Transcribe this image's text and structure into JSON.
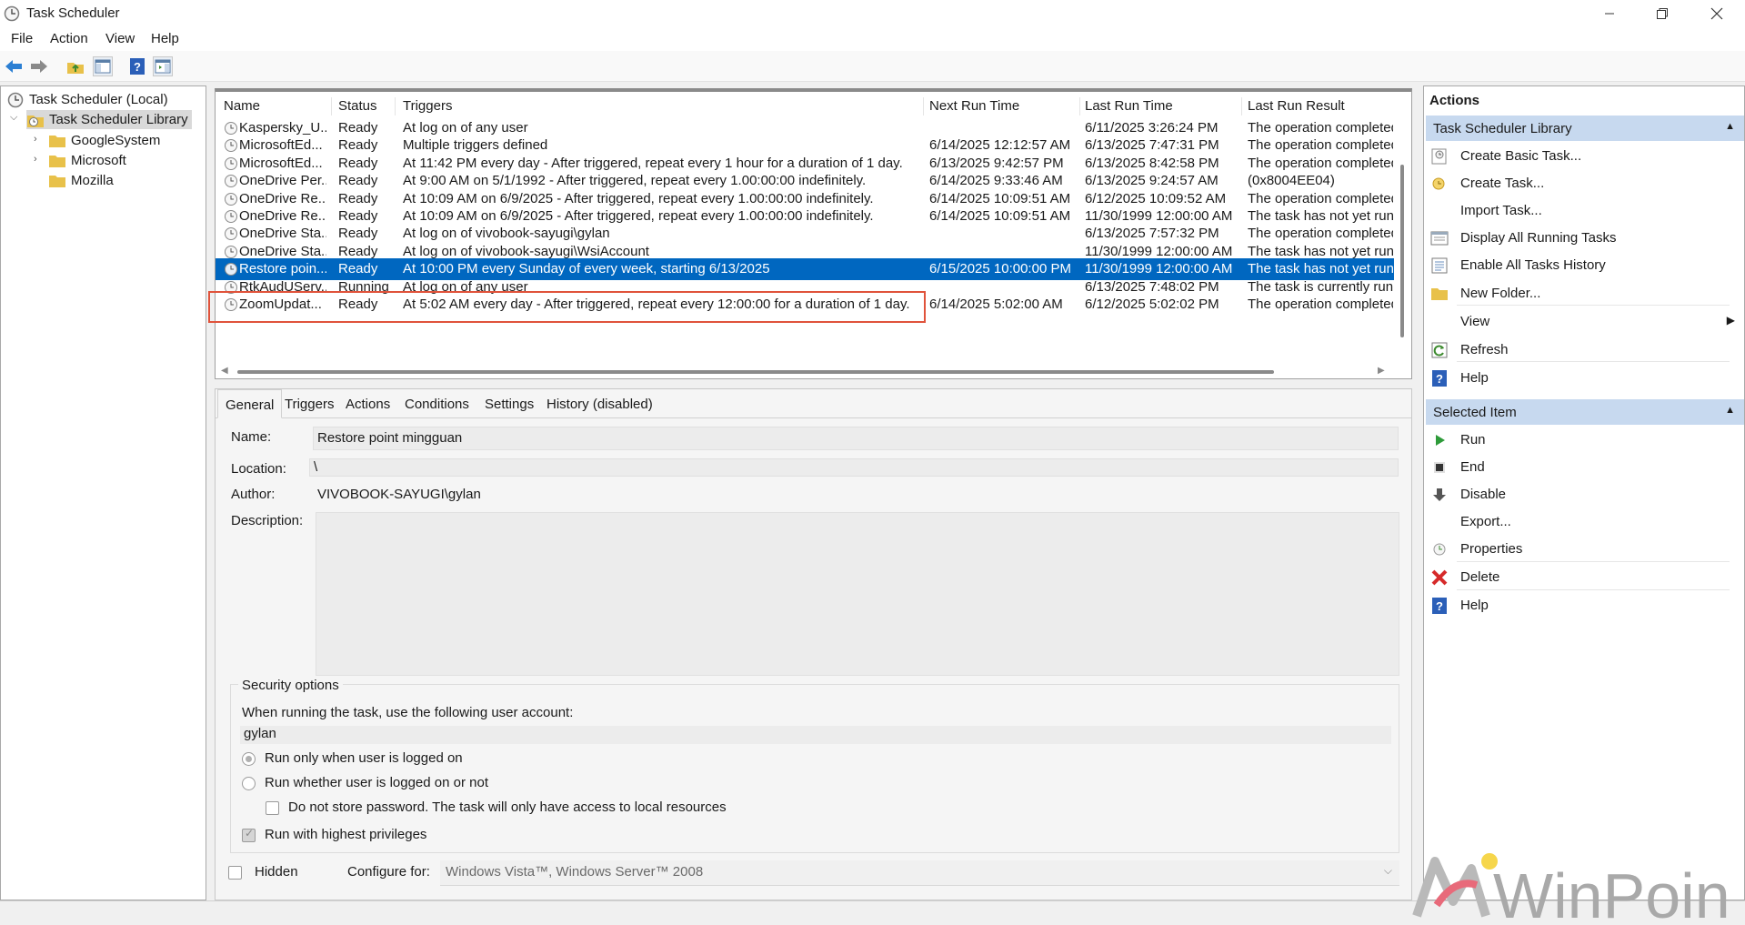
{
  "window": {
    "title": "Task Scheduler"
  },
  "menu": [
    "File",
    "Action",
    "View",
    "Help"
  ],
  "tree": {
    "root": "Task Scheduler (Local)",
    "library": "Task Scheduler Library",
    "folders": [
      "GoogleSystem",
      "Microsoft",
      "Mozilla"
    ]
  },
  "tasks": {
    "columns": [
      "Name",
      "Status",
      "Triggers",
      "Next Run Time",
      "Last Run Time",
      "Last Run Result"
    ],
    "rows": [
      [
        "Kaspersky_U...",
        "Ready",
        "At log on of any user",
        "",
        "6/11/2025 3:26:24 PM",
        "The operation completed"
      ],
      [
        "MicrosoftEd...",
        "Ready",
        "Multiple triggers defined",
        "6/14/2025 12:12:57 AM",
        "6/13/2025 7:47:31 PM",
        "The operation completed"
      ],
      [
        "MicrosoftEd...",
        "Ready",
        "At 11:42 PM every day - After triggered, repeat every 1 hour for a duration of 1 day.",
        "6/13/2025 9:42:57 PM",
        "6/13/2025 8:42:58 PM",
        "The operation completed"
      ],
      [
        "OneDrive Per...",
        "Ready",
        "At 9:00 AM on 5/1/1992 - After triggered, repeat every 1.00:00:00 indefinitely.",
        "6/14/2025 9:33:46 AM",
        "6/13/2025 9:24:57 AM",
        "(0x8004EE04)"
      ],
      [
        "OneDrive Re...",
        "Ready",
        "At 10:09 AM on 6/9/2025 - After triggered, repeat every 1.00:00:00 indefinitely.",
        "6/14/2025 10:09:51 AM",
        "6/12/2025 10:09:52 AM",
        "The operation completed"
      ],
      [
        "OneDrive Re...",
        "Ready",
        "At 10:09 AM on 6/9/2025 - After triggered, repeat every 1.00:00:00 indefinitely.",
        "6/14/2025 10:09:51 AM",
        "11/30/1999 12:00:00 AM",
        "The task has not yet run."
      ],
      [
        "OneDrive Sta...",
        "Ready",
        "At log on of vivobook-sayugi\\gylan",
        "",
        "6/13/2025 7:57:32 PM",
        "The operation completed"
      ],
      [
        "OneDrive Sta...",
        "Ready",
        "At log on of vivobook-sayugi\\WsiAccount",
        "",
        "11/30/1999 12:00:00 AM",
        "The task has not yet run."
      ],
      [
        "Restore poin...",
        "Ready",
        "At 10:00 PM every Sunday of every week, starting 6/13/2025",
        "6/15/2025 10:00:00 PM",
        "11/30/1999 12:00:00 AM",
        "The task has not yet run."
      ],
      [
        "RtkAudUServ...",
        "Running",
        "At log on of any user",
        "",
        "6/13/2025 7:48:02 PM",
        "The task is currently runn"
      ],
      [
        "ZoomUpdat...",
        "Ready",
        "At 5:02 AM every day - After triggered, repeat every 12:00:00 for a duration of 1 day.",
        "6/14/2025 5:02:00 AM",
        "6/12/2025 5:02:02 PM",
        "The operation completed"
      ]
    ],
    "selected_index": 8
  },
  "details": {
    "tabs": [
      "General",
      "Triggers",
      "Actions",
      "Conditions",
      "Settings",
      "History (disabled)"
    ],
    "name_label": "Name:",
    "name_value": "Restore point mingguan",
    "location_label": "Location:",
    "location_value": "\\",
    "author_label": "Author:",
    "author_value": "VIVOBOOK-SAYUGI\\gylan",
    "description_label": "Description:",
    "security_title": "Security options",
    "account_prompt": "When running the task, use the following user account:",
    "account_value": "gylan",
    "radio_logged_on": "Run only when user is logged on",
    "radio_whether": "Run whether user is logged on or not",
    "no_store_password": "Do not store password.  The task will only have access to local resources",
    "highest_privileges": "Run with highest privileges",
    "hidden": "Hidden",
    "configure_label": "Configure for:",
    "configure_value": "Windows Vista™, Windows Server™ 2008"
  },
  "actions_pane": {
    "title": "Actions",
    "section_library": "Task Scheduler Library",
    "library_items": [
      "Create Basic Task...",
      "Create Task...",
      "Import Task...",
      "Display All Running Tasks",
      "Enable All Tasks History",
      "New Folder...",
      "View",
      "Refresh",
      "Help"
    ],
    "section_selected": "Selected Item",
    "selected_items": [
      "Run",
      "End",
      "Disable",
      "Export...",
      "Properties",
      "Delete",
      "Help"
    ]
  },
  "watermark": "WinPoin",
  "colors": {
    "selection": "#0067c0",
    "highlight_box": "#e0533b",
    "section_header": "#c7d9ef"
  }
}
